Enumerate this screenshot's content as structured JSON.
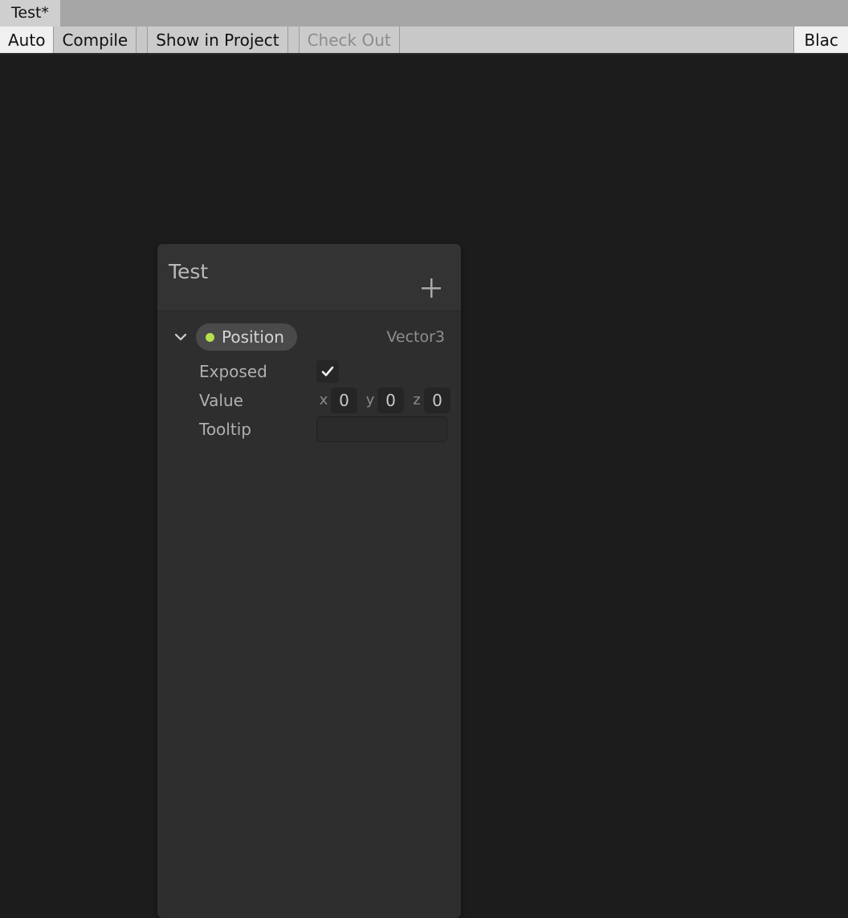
{
  "window": {
    "tabs": [
      {
        "label": "Test*",
        "active": true
      }
    ]
  },
  "toolbar": {
    "auto_label": "Auto",
    "compile_label": "Compile",
    "show_in_project_label": "Show in Project",
    "check_out_label": "Check Out",
    "blackboard_label": "Blac"
  },
  "blackboard": {
    "title": "Test",
    "add_icon": "plus-icon",
    "variables": [
      {
        "name": "Position",
        "type": "Vector3",
        "expanded": true,
        "expand_icon": "chevron-down-icon",
        "dot_color": "#b4e051",
        "fields": {
          "exposed": {
            "label": "Exposed",
            "checked": true
          },
          "value": {
            "label": "Value",
            "components": [
              {
                "axis": "x",
                "value": "0"
              },
              {
                "axis": "y",
                "value": "0"
              },
              {
                "axis": "z",
                "value": "0"
              }
            ]
          },
          "tooltip": {
            "label": "Tooltip",
            "value": "",
            "placeholder": ""
          }
        }
      }
    ]
  },
  "colors": {
    "canvas_bg": "#1c1c1c",
    "panel_bg": "#333333",
    "panel_body_bg": "#2e2e2e",
    "accent_green": "#b4e051",
    "toolbar_bg": "#c8c8c8"
  }
}
